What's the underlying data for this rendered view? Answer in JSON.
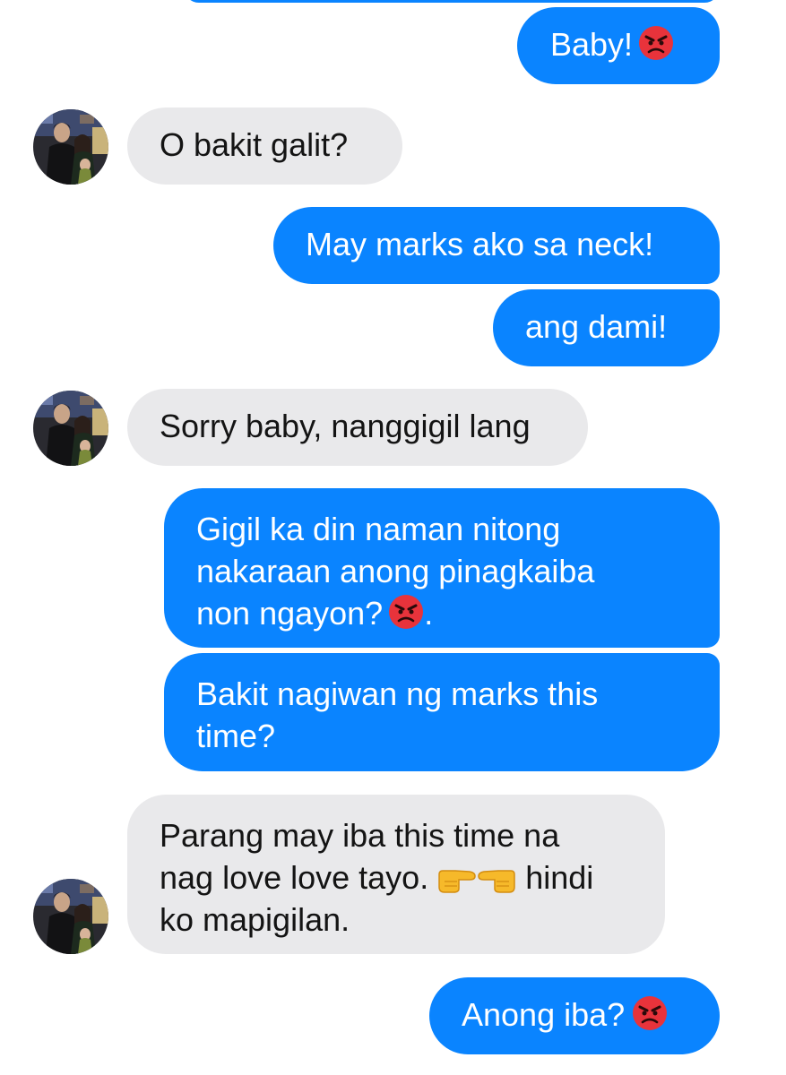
{
  "messages": [
    {
      "side": "out",
      "text_before": "Baby!",
      "emoji": "angry-face-icon"
    },
    {
      "side": "in",
      "text": "O bakit galit?"
    },
    {
      "side": "out",
      "text": "May marks ako sa neck!"
    },
    {
      "side": "out",
      "text": "ang dami!"
    },
    {
      "side": "in",
      "text": "Sorry baby, nanggigil lang"
    },
    {
      "side": "out",
      "text_line1": "Gigil ka din naman nitong",
      "text_line2": "nakaraan anong pinagkaiba",
      "text_line3": "non ngayon?",
      "emoji": "angry-face-icon",
      "text_after": "."
    },
    {
      "side": "out",
      "text": "Bakit nagiwan ng marks this time?"
    },
    {
      "side": "in",
      "text_line1": "Parang may iba this time na",
      "text_line2_before": "nag love love tayo.",
      "emoji": [
        "point-right-icon",
        "point-left-icon"
      ],
      "text_line2_after": "hindi",
      "text_line3": "ko mapigilan."
    },
    {
      "side": "out",
      "text_before": "Anong iba?",
      "emoji": "angry-face-icon"
    }
  ],
  "colors": {
    "outgoing_bubble": "#0a84ff",
    "incoming_bubble": "#e9e9eb",
    "outgoing_text": "#ffffff",
    "incoming_text": "#141414"
  }
}
